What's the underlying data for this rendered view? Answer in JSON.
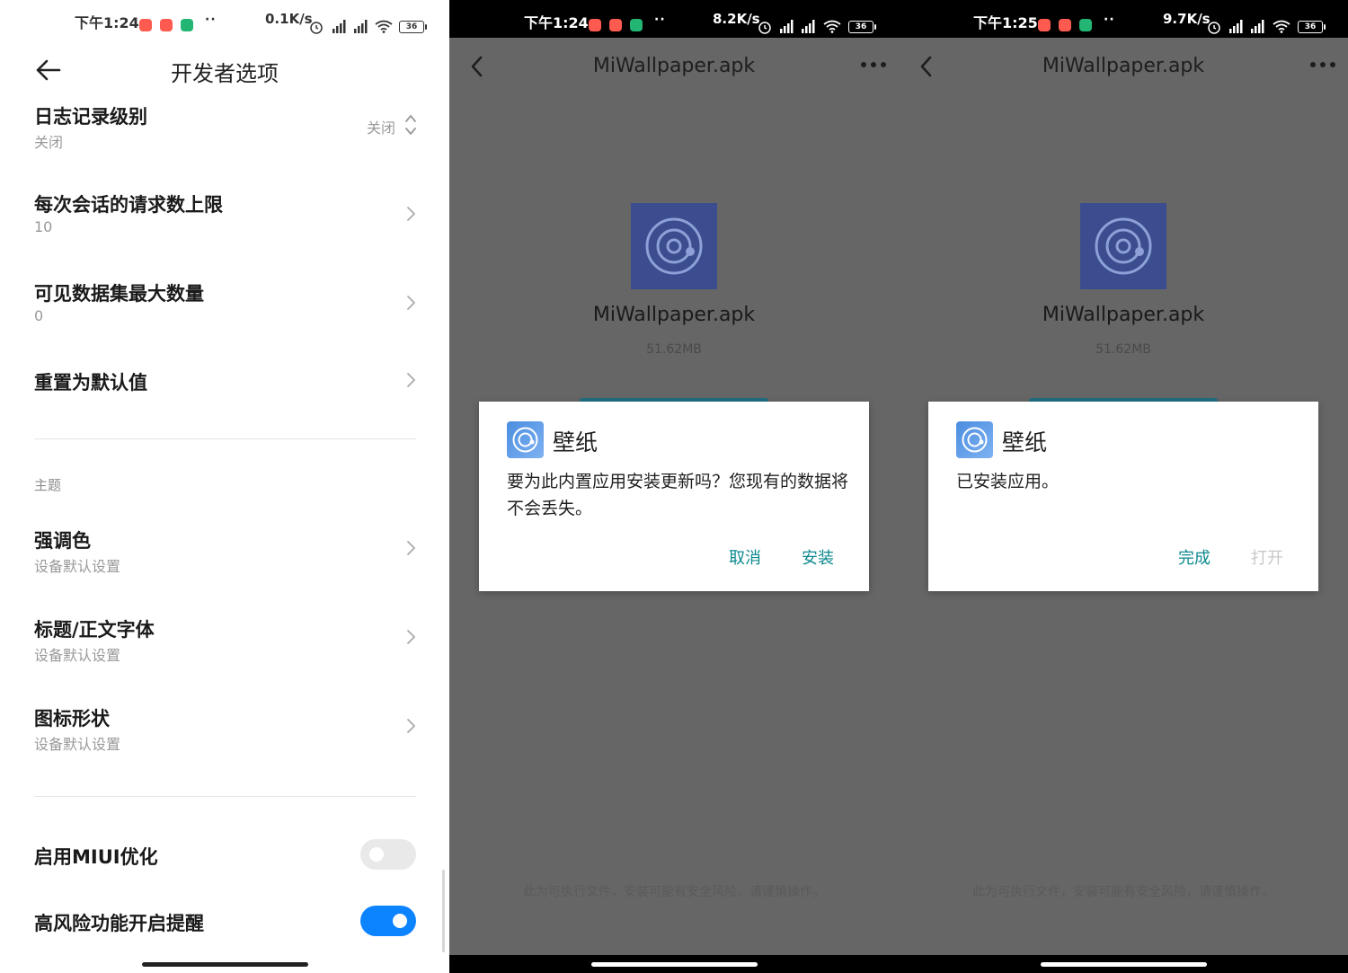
{
  "colors": {
    "accent_teal": "#0d8a8f",
    "disabled_text": "#c8c8c8",
    "toggle_on": "#0d84ff",
    "overlay_gray": "#666666"
  },
  "settings_screen": {
    "status_bar": {
      "time": "下午1:24",
      "dots": "··",
      "speed": "0.1K/s",
      "battery": "36"
    },
    "back_icon": "arrow-left-icon",
    "title": "开发者选项",
    "rows": [
      {
        "title": "日志记录级别",
        "subtitle": "关闭",
        "value": "关闭",
        "control": "updown-icon"
      },
      {
        "title": "每次会话的请求数上限",
        "subtitle": "10",
        "control": "chevron-right-icon"
      },
      {
        "title": "可见数据集最大数量",
        "subtitle": "0",
        "control": "chevron-right-icon"
      },
      {
        "title": "重置为默认值",
        "control": "chevron-right-icon"
      }
    ],
    "section_label": "主题",
    "theme_rows": [
      {
        "title": "强调色",
        "subtitle": "设备默认设置"
      },
      {
        "title": "标题/正文字体",
        "subtitle": "设备默认设置"
      },
      {
        "title": "图标形状",
        "subtitle": "设备默认设置"
      }
    ],
    "toggles": [
      {
        "title": "启用MIUI优化",
        "on": false
      },
      {
        "title": "高风险功能开启提醒",
        "on": true
      }
    ]
  },
  "installer_confirm": {
    "status_bar": {
      "time": "下午1:24",
      "dots": "··",
      "speed": "8.2K/s",
      "battery": "36"
    },
    "title": "MiWallpaper.apk",
    "more_icon": "more-dots-icon",
    "file_name": "MiWallpaper.apk",
    "file_size": "51.62MB",
    "dialog": {
      "app_name": "壁纸",
      "message": "要为此内置应用安装更新吗？您现有的数据将不会丢失。",
      "cancel_label": "取消",
      "confirm_label": "安装"
    },
    "warning": "此为可执行文件，安装可能有安全风险，请谨慎操作。"
  },
  "installer_done": {
    "status_bar": {
      "time": "下午1:25",
      "dots": "··",
      "speed": "9.7K/s",
      "battery": "36"
    },
    "title": "MiWallpaper.apk",
    "more_icon": "more-dots-icon",
    "file_name": "MiWallpaper.apk",
    "file_size": "51.62MB",
    "dialog": {
      "app_name": "壁纸",
      "message": "已安装应用。",
      "done_label": "完成",
      "open_label": "打开"
    },
    "warning": "此为可执行文件，安装可能有安全风险，请谨慎操作。"
  }
}
